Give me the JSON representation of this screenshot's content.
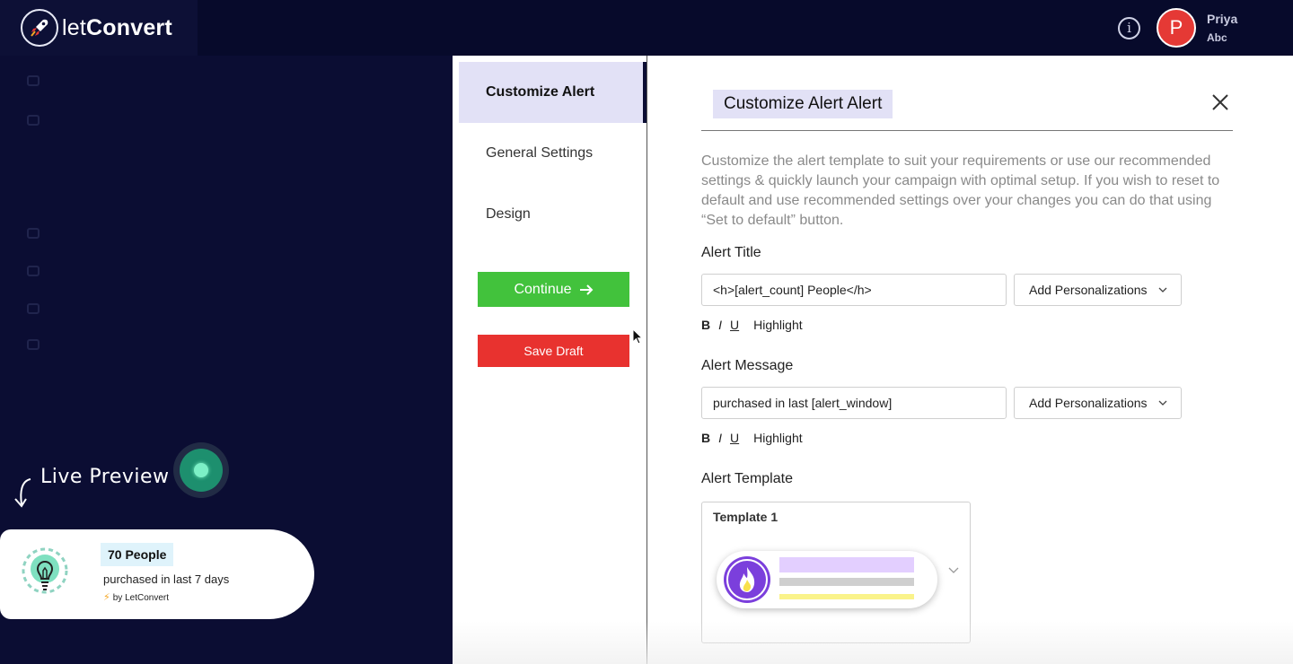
{
  "brand": {
    "name_light": "let",
    "name_bold": "Convert"
  },
  "user": {
    "initial": "P",
    "name": "Priya",
    "org": "Abc"
  },
  "live_preview": {
    "label": "Live Preview",
    "count_text": "70 People",
    "message": "purchased in last 7 days",
    "by_text": "by LetConvert"
  },
  "steps": [
    {
      "label": "Customize Alert"
    },
    {
      "label": "General Settings"
    },
    {
      "label": "Design"
    }
  ],
  "buttons": {
    "continue": "Continue",
    "save_draft": "Save Draft"
  },
  "form": {
    "heading": "Customize Alert Alert",
    "description": "Customize the alert template to suit your requirements or use our recommended settings & quickly launch your campaign with optimal setup. If you wish to reset to default and use recommended settings over your changes you can do that using “Set to default” button.",
    "alert_title": {
      "label": "Alert Title",
      "value": "<h>[alert_count] People</h>",
      "personalize": "Add Personalizations"
    },
    "alert_message": {
      "label": "Alert Message",
      "value": "purchased in last [alert_window]",
      "personalize": "Add Personalizations"
    },
    "format": {
      "bold": "B",
      "italic": "I",
      "underline": "U",
      "highlight": "Highlight"
    },
    "alert_template": {
      "label": "Alert Template",
      "selected": "Template 1"
    }
  },
  "colors": {
    "primary_dark": "#0b0d33",
    "continue": "#42c23c",
    "save_draft": "#e8322f",
    "active_step": "#e2e1f6",
    "avatar": "#e53935"
  }
}
